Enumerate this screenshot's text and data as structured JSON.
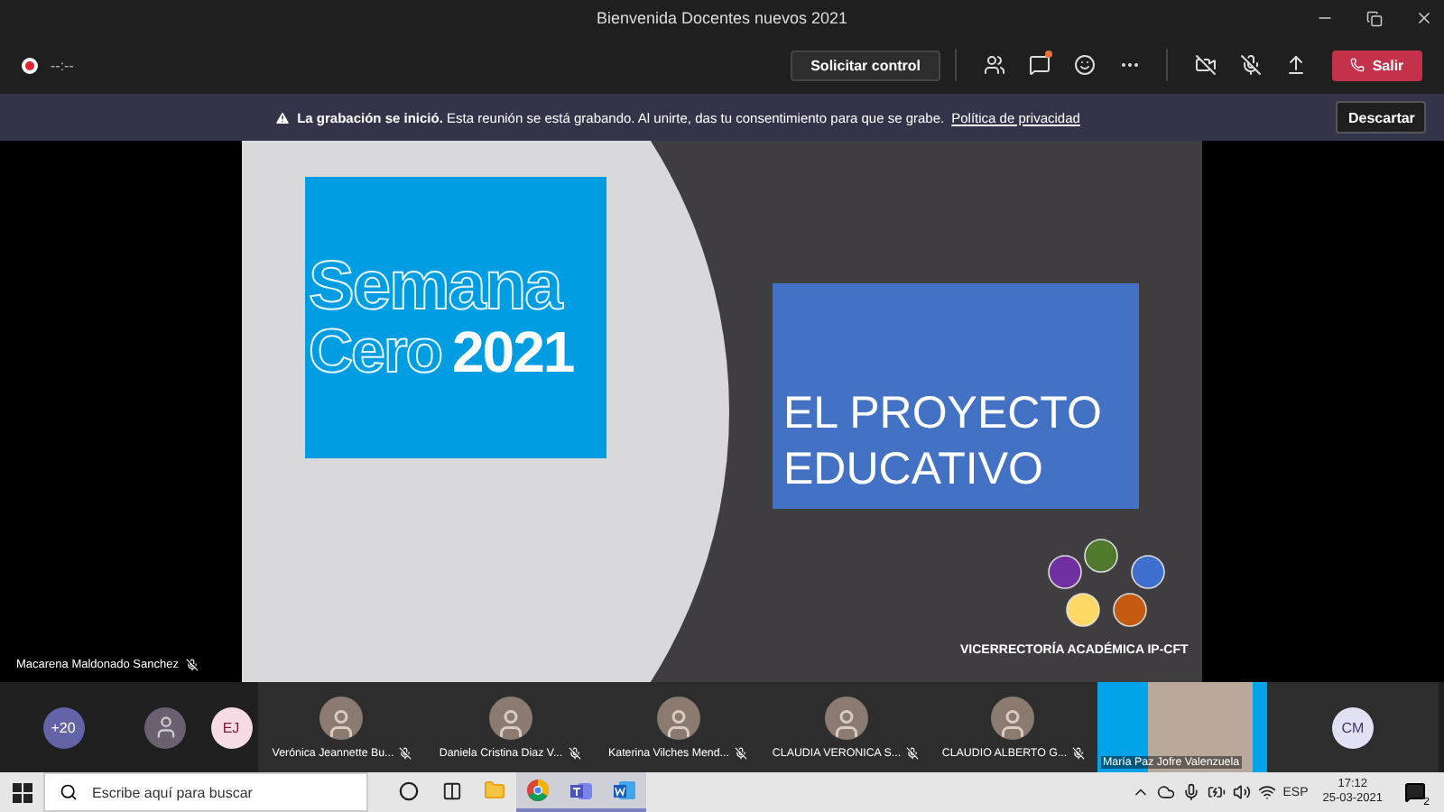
{
  "window": {
    "title": "Bienvenida Docentes nuevos 2021"
  },
  "toolbar": {
    "recording": true,
    "timer": "--:--",
    "request_control": "Solicitar control",
    "chat_unread": true,
    "leave": "Salir"
  },
  "banner": {
    "title": "La grabación se inició.",
    "message": "Esta reunión se está grabando. Al unirte, das tu consentimiento para que se grabe.",
    "link": "Política de privacidad",
    "dismiss": "Descartar"
  },
  "stage": {
    "speaker": {
      "name": "Macarena Maldonado Sanchez",
      "muted": true
    },
    "slide": {
      "title_outline": [
        "Semana",
        "Cero"
      ],
      "title_year": "2021",
      "heading": [
        "EL PROYECTO",
        "EDUCATIVO"
      ],
      "logo_circles": [
        {
          "color": "#4f7a2e"
        },
        {
          "color": "#3f6fcf"
        },
        {
          "color": "#c55a11"
        },
        {
          "color": "#ffd966"
        },
        {
          "color": "#7030a0"
        }
      ],
      "footer": "VICERRECTORÍA ACADÉMICA IP-CFT"
    }
  },
  "participants": [
    {
      "kind": "count",
      "label": "+20"
    },
    {
      "kind": "photo"
    },
    {
      "kind": "initials",
      "label": "EJ"
    },
    {
      "kind": "tile",
      "name": "Verónica Jeannette Bu...",
      "muted": true
    },
    {
      "kind": "tile",
      "name": "Daniela Cristina Diaz V...",
      "muted": true
    },
    {
      "kind": "tile",
      "name": "Katerina Vilches Mend...",
      "muted": true
    },
    {
      "kind": "tile",
      "name": "CLAUDIA VERONICA S...",
      "muted": true
    },
    {
      "kind": "tile",
      "name": "CLAUDIO ALBERTO G...",
      "muted": true
    },
    {
      "kind": "video",
      "name": "María Paz Jofre Valenzuela"
    },
    {
      "kind": "initials",
      "label": "CM"
    }
  ],
  "taskbar": {
    "search": {
      "placeholder": "Escribe aquí para buscar"
    },
    "apps": [
      {
        "kind": "cortana",
        "active": false
      },
      {
        "kind": "taskview",
        "active": false
      },
      {
        "kind": "explorer",
        "active": false
      },
      {
        "kind": "chrome",
        "active": true
      },
      {
        "kind": "teams",
        "active": true
      },
      {
        "kind": "word",
        "active": true
      }
    ],
    "language": "ESP",
    "time": "17:12",
    "date": "25-03-2021",
    "notifications": "2"
  }
}
